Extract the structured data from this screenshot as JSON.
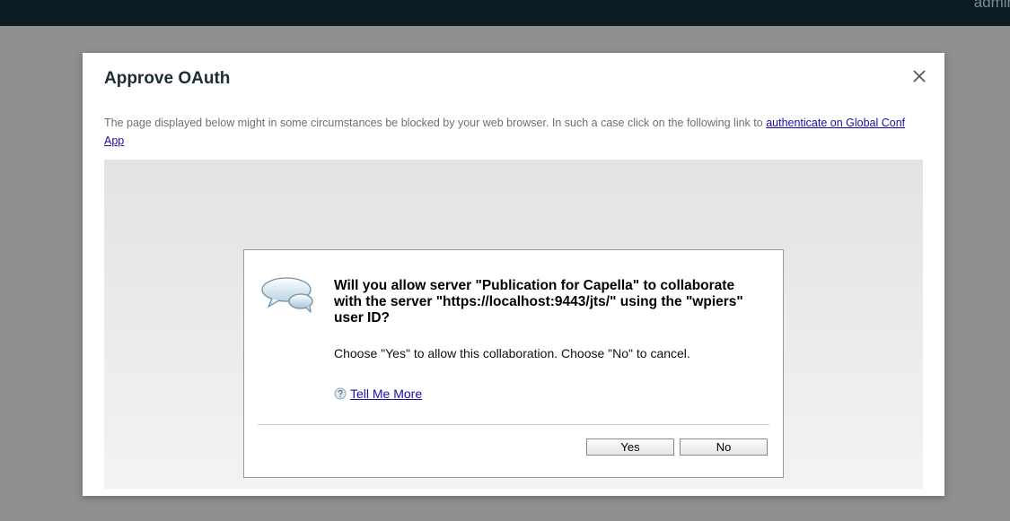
{
  "topbar": {
    "user_label": "admin"
  },
  "modal": {
    "title": "Approve OAuth",
    "close_icon": "close-icon",
    "notice": {
      "text": "The page displayed below might in some circumstances be blocked by your web browser. In such a case click on the following link to ",
      "link_text": "authenticate on Global Conf App"
    }
  },
  "dialog": {
    "icon": "speech-bubbles-icon",
    "question": "Will you allow server \"Publication for Capella\" to collaborate with the server \"https://localhost:9443/jts/\" using the \"wpiers\" user ID?",
    "instruction": "Choose \"Yes\" to allow this collaboration. Choose \"No\" to cancel.",
    "tell_more": {
      "icon": "help-icon",
      "label": "Tell Me More"
    },
    "buttons": {
      "yes": "Yes",
      "no": "No"
    }
  },
  "colors": {
    "topbar": "#0c1b22",
    "overlay": "#8f8f8f",
    "title": "#1d2d35",
    "link": "#1a0dab"
  }
}
